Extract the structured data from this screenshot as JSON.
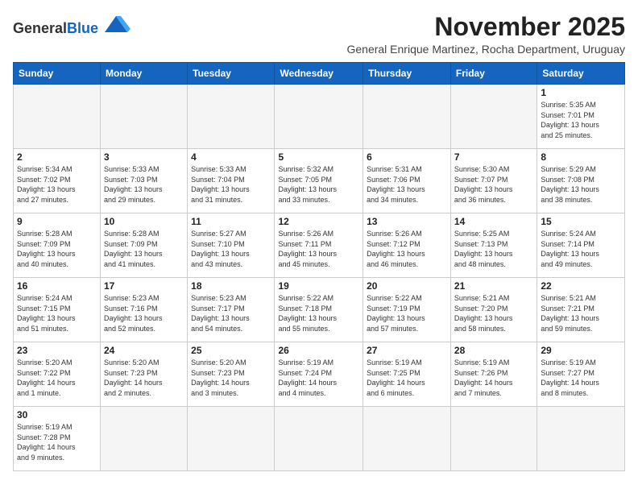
{
  "logo": {
    "general": "General",
    "blue": "Blue"
  },
  "title": "November 2025",
  "subtitle": "General Enrique Martinez, Rocha Department, Uruguay",
  "days_of_week": [
    "Sunday",
    "Monday",
    "Tuesday",
    "Wednesday",
    "Thursday",
    "Friday",
    "Saturday"
  ],
  "weeks": [
    [
      {
        "day": null,
        "info": null
      },
      {
        "day": null,
        "info": null
      },
      {
        "day": null,
        "info": null
      },
      {
        "day": null,
        "info": null
      },
      {
        "day": null,
        "info": null
      },
      {
        "day": null,
        "info": null
      },
      {
        "day": "1",
        "info": "Sunrise: 5:35 AM\nSunset: 7:01 PM\nDaylight: 13 hours\nand 25 minutes."
      }
    ],
    [
      {
        "day": "2",
        "info": "Sunrise: 5:34 AM\nSunset: 7:02 PM\nDaylight: 13 hours\nand 27 minutes."
      },
      {
        "day": "3",
        "info": "Sunrise: 5:33 AM\nSunset: 7:03 PM\nDaylight: 13 hours\nand 29 minutes."
      },
      {
        "day": "4",
        "info": "Sunrise: 5:33 AM\nSunset: 7:04 PM\nDaylight: 13 hours\nand 31 minutes."
      },
      {
        "day": "5",
        "info": "Sunrise: 5:32 AM\nSunset: 7:05 PM\nDaylight: 13 hours\nand 33 minutes."
      },
      {
        "day": "6",
        "info": "Sunrise: 5:31 AM\nSunset: 7:06 PM\nDaylight: 13 hours\nand 34 minutes."
      },
      {
        "day": "7",
        "info": "Sunrise: 5:30 AM\nSunset: 7:07 PM\nDaylight: 13 hours\nand 36 minutes."
      },
      {
        "day": "8",
        "info": "Sunrise: 5:29 AM\nSunset: 7:08 PM\nDaylight: 13 hours\nand 38 minutes."
      }
    ],
    [
      {
        "day": "9",
        "info": "Sunrise: 5:28 AM\nSunset: 7:09 PM\nDaylight: 13 hours\nand 40 minutes."
      },
      {
        "day": "10",
        "info": "Sunrise: 5:28 AM\nSunset: 7:09 PM\nDaylight: 13 hours\nand 41 minutes."
      },
      {
        "day": "11",
        "info": "Sunrise: 5:27 AM\nSunset: 7:10 PM\nDaylight: 13 hours\nand 43 minutes."
      },
      {
        "day": "12",
        "info": "Sunrise: 5:26 AM\nSunset: 7:11 PM\nDaylight: 13 hours\nand 45 minutes."
      },
      {
        "day": "13",
        "info": "Sunrise: 5:26 AM\nSunset: 7:12 PM\nDaylight: 13 hours\nand 46 minutes."
      },
      {
        "day": "14",
        "info": "Sunrise: 5:25 AM\nSunset: 7:13 PM\nDaylight: 13 hours\nand 48 minutes."
      },
      {
        "day": "15",
        "info": "Sunrise: 5:24 AM\nSunset: 7:14 PM\nDaylight: 13 hours\nand 49 minutes."
      }
    ],
    [
      {
        "day": "16",
        "info": "Sunrise: 5:24 AM\nSunset: 7:15 PM\nDaylight: 13 hours\nand 51 minutes."
      },
      {
        "day": "17",
        "info": "Sunrise: 5:23 AM\nSunset: 7:16 PM\nDaylight: 13 hours\nand 52 minutes."
      },
      {
        "day": "18",
        "info": "Sunrise: 5:23 AM\nSunset: 7:17 PM\nDaylight: 13 hours\nand 54 minutes."
      },
      {
        "day": "19",
        "info": "Sunrise: 5:22 AM\nSunset: 7:18 PM\nDaylight: 13 hours\nand 55 minutes."
      },
      {
        "day": "20",
        "info": "Sunrise: 5:22 AM\nSunset: 7:19 PM\nDaylight: 13 hours\nand 57 minutes."
      },
      {
        "day": "21",
        "info": "Sunrise: 5:21 AM\nSunset: 7:20 PM\nDaylight: 13 hours\nand 58 minutes."
      },
      {
        "day": "22",
        "info": "Sunrise: 5:21 AM\nSunset: 7:21 PM\nDaylight: 13 hours\nand 59 minutes."
      }
    ],
    [
      {
        "day": "23",
        "info": "Sunrise: 5:20 AM\nSunset: 7:22 PM\nDaylight: 14 hours\nand 1 minute."
      },
      {
        "day": "24",
        "info": "Sunrise: 5:20 AM\nSunset: 7:23 PM\nDaylight: 14 hours\nand 2 minutes."
      },
      {
        "day": "25",
        "info": "Sunrise: 5:20 AM\nSunset: 7:23 PM\nDaylight: 14 hours\nand 3 minutes."
      },
      {
        "day": "26",
        "info": "Sunrise: 5:19 AM\nSunset: 7:24 PM\nDaylight: 14 hours\nand 4 minutes."
      },
      {
        "day": "27",
        "info": "Sunrise: 5:19 AM\nSunset: 7:25 PM\nDaylight: 14 hours\nand 6 minutes."
      },
      {
        "day": "28",
        "info": "Sunrise: 5:19 AM\nSunset: 7:26 PM\nDaylight: 14 hours\nand 7 minutes."
      },
      {
        "day": "29",
        "info": "Sunrise: 5:19 AM\nSunset: 7:27 PM\nDaylight: 14 hours\nand 8 minutes."
      }
    ],
    [
      {
        "day": "30",
        "info": "Sunrise: 5:19 AM\nSunset: 7:28 PM\nDaylight: 14 hours\nand 9 minutes."
      },
      {
        "day": null,
        "info": null
      },
      {
        "day": null,
        "info": null
      },
      {
        "day": null,
        "info": null
      },
      {
        "day": null,
        "info": null
      },
      {
        "day": null,
        "info": null
      },
      {
        "day": null,
        "info": null
      }
    ]
  ]
}
